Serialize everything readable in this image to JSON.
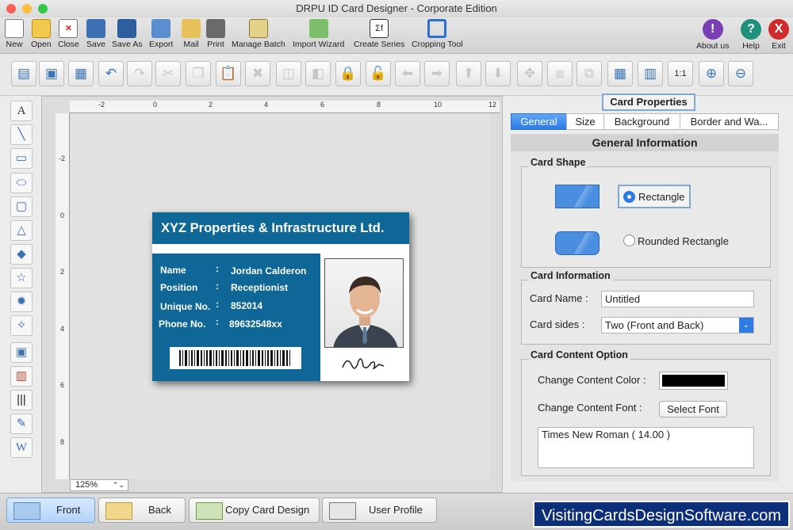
{
  "window": {
    "title": "DRPU ID Card Designer - Corporate Edition"
  },
  "toolbar": {
    "items": [
      {
        "label": "New",
        "icon": "new-file-icon"
      },
      {
        "label": "Open",
        "icon": "open-folder-icon"
      },
      {
        "label": "Close",
        "icon": "close-file-icon"
      },
      {
        "label": "Save",
        "icon": "save-icon"
      },
      {
        "label": "Save As",
        "icon": "save-as-icon"
      },
      {
        "label": "Export",
        "icon": "export-icon"
      },
      {
        "label": "Mail",
        "icon": "mail-icon"
      },
      {
        "label": "Print",
        "icon": "printer-icon"
      },
      {
        "label": "Manage Batch",
        "icon": "manage-batch-icon"
      },
      {
        "label": "Import Wizard",
        "icon": "import-wizard-icon"
      },
      {
        "label": "Create Series",
        "icon": "create-series-icon"
      },
      {
        "label": "Cropping Tool",
        "icon": "crop-icon"
      }
    ],
    "right": [
      {
        "label": "About us",
        "glyph": "!",
        "color": "#7b3fb5"
      },
      {
        "label": "Help",
        "glyph": "?",
        "color": "#1e8f7b"
      },
      {
        "label": "Exit",
        "glyph": "X",
        "color": "#d12b2b"
      }
    ]
  },
  "ruler": {
    "h": [
      "-2",
      "0",
      "2",
      "4",
      "6",
      "8",
      "10",
      "12"
    ],
    "v": [
      "-2",
      "0",
      "2",
      "4",
      "6",
      "8"
    ]
  },
  "zoom": {
    "value": "125%"
  },
  "card": {
    "company": "XYZ Properties & Infrastructure Ltd.",
    "fields": [
      {
        "label": "Name",
        "sep": ":",
        "value": "Jordan Calderon"
      },
      {
        "label": "Position",
        "sep": ":",
        "value": "Receptionist"
      },
      {
        "label": "Unique No.",
        "sep": ":",
        "value": "852014"
      },
      {
        "label": "Phone No.",
        "sep": ":",
        "value": "89632548xx"
      }
    ]
  },
  "panel": {
    "title": "Card Properties",
    "tabs": [
      "General",
      "Size",
      "Background",
      "Border and Wa..."
    ],
    "section_title": "General Information",
    "card_shape": {
      "title": "Card Shape",
      "options": [
        "Rectangle",
        "Rounded Rectangle"
      ],
      "selected": "Rectangle"
    },
    "card_info": {
      "title": "Card Information",
      "name_label": "Card Name :",
      "name_value": "Untitled",
      "sides_label": "Card sides :",
      "sides_value": "Two (Front and Back)"
    },
    "content": {
      "title": "Card Content Option",
      "color_label": "Change Content Color :",
      "color_value": "#000000",
      "font_label": "Change Content Font :",
      "font_button": "Select Font",
      "font_value": "Times New Roman ( 14.00 )"
    }
  },
  "bottom": {
    "buttons": [
      "Front",
      "Back",
      "Copy Card Design",
      "User Profile"
    ],
    "watermark": "VisitingCardsDesignSoftware.com"
  }
}
